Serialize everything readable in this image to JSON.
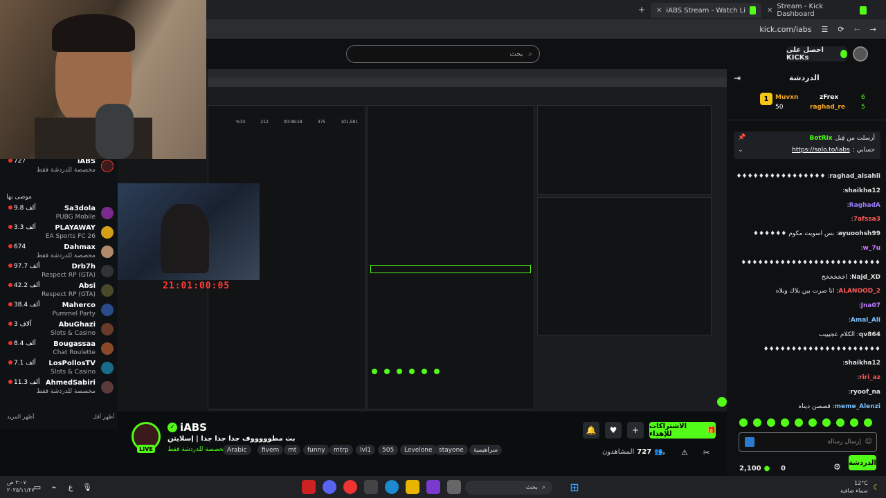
{
  "browser": {
    "tabs": [
      {
        "title": "iABS Stream - Watch Live on K",
        "active": true
      },
      {
        "title": "Stream - Kick Dashboard",
        "active": false
      }
    ],
    "url": "kick.com/iabs"
  },
  "header": {
    "search_placeholder": "بحث",
    "get_kicks": "احصل على KICKs"
  },
  "sidebar": {
    "top_channel": {
      "name": "iABS",
      "count": "727",
      "subtitle": "مخصصة للدردشة فقط"
    },
    "recommended_title": "موصى بها",
    "items": [
      {
        "name": "Sa3dola",
        "count": "9.8 ألف",
        "game": "PUBG Mobile",
        "color": "#7a2a8a"
      },
      {
        "name": "PLAYAWAY",
        "count": "3.3 ألف",
        "game": "EA Sports FC 26",
        "color": "#d4a017"
      },
      {
        "name": "Dahmax",
        "count": "674",
        "game": "مخصصة للدردشة فقط",
        "color": "#b08a6a"
      },
      {
        "name": "Drb7h",
        "count": "97.7 ألف",
        "game": "Respect RP (GTA)",
        "color": "#333"
      },
      {
        "name": "Absi",
        "count": "42.2 ألف",
        "game": "Respect RP (GTA)",
        "color": "#4a4a2a"
      },
      {
        "name": "Maherco",
        "count": "38.4 ألف",
        "game": "Pummel Party",
        "color": "#2a4a8a"
      },
      {
        "name": "AbuGhazi",
        "count": "3 آلاف",
        "game": "Slots & Casino",
        "color": "#6a3a2a"
      },
      {
        "name": "Bougassaa",
        "count": "8.4 ألف",
        "game": "Chat Roulette",
        "color": "#8a4a2a"
      },
      {
        "name": "LosPollosTV",
        "count": "7.1 ألف",
        "game": "Slots & Casino",
        "color": "#1a6a8a"
      },
      {
        "name": "AhmedSabiri",
        "count": "11.3 ألف",
        "game": "مخصصة للدردشة فقط",
        "color": "#5a3a3a"
      }
    ],
    "show_more": "أظهر المزيد",
    "show_less": "أظهر أقل"
  },
  "video": {
    "timer": "21:01:00:05",
    "inner_stats": [
      "641",
      "101,581",
      "375",
      "00:08:18",
      "212",
      "%33"
    ]
  },
  "stream": {
    "channel_name": "iABS",
    "live": "LIVE",
    "title": "بث مطوووووف جدا جدا جدا | إسلايتن",
    "category": "مخصصة للدردشة فقط",
    "tags": [
      "Arabic",
      "fivem",
      "mt",
      "funny",
      "mtrp",
      "lvl1",
      "505",
      "Levelone",
      "stayone",
      "سراهيمية"
    ],
    "subscribe": "الاشتراكات للإهداء",
    "viewers": "727",
    "viewers_label": "المشاهدون"
  },
  "chat": {
    "title": "الدردشة",
    "leaders": [
      {
        "name": "zFrex",
        "count": "6"
      },
      {
        "name": "Muvxn",
        "count": "50"
      },
      {
        "name": "raghad_re",
        "count": "5"
      }
    ],
    "pinned_by": "أرسلت من قِبل",
    "pinned_user": "BotRix",
    "pinned_text": "حسابي :",
    "pinned_link": "https://solo.to/iabs",
    "messages": [
      {
        "user": "raghad_alsahli",
        "text": "♦♦♦♦♦♦♦♦♦♦♦♦♦♦♦♦",
        "color": "#e0e0e0"
      },
      {
        "user": "shaikha12",
        "text": "",
        "color": "#e0e0e0"
      },
      {
        "user": "RaghadA",
        "text": "",
        "color": "#9a7cff"
      },
      {
        "user": "7afssa3",
        "text": "",
        "color": "#ff5a5a"
      },
      {
        "user": "ayuoohsh99",
        "text": "بس اسويت مكوم ♦♦♦♦♦♦",
        "color": "#e0e0e0"
      },
      {
        "user": "w_7u",
        "text": "",
        "color": "#d07cff"
      },
      {
        "user": "",
        "text": "♦♦♦♦♦♦♦♦♦♦♦♦♦♦♦♦♦♦♦♦♦♦♦♦♦",
        "color": "#e0e0e0"
      },
      {
        "user": "Najd_XD",
        "text": "اخخخخخخ",
        "color": "#e0e0e0"
      },
      {
        "user": "ALANOOD_2",
        "text": "انا صرت بين بلاك وبلاه",
        "color": "#ff5a5a"
      },
      {
        "user": "Jna07",
        "text": "",
        "color": "#c07cff"
      },
      {
        "user": "Amal_Ali",
        "text": "",
        "color": "#7cc0ff"
      },
      {
        "user": "qv864",
        "text": "الكلام عجيييب",
        "color": "#e0e0e0"
      },
      {
        "user": "",
        "text": "♦♦♦♦♦♦♦♦♦♦♦♦♦♦♦♦♦♦♦♦♦",
        "color": "#e0e0e0"
      },
      {
        "user": "shaikha12",
        "text": "",
        "color": "#e0e0e0"
      },
      {
        "user": "riri_az",
        "text": "",
        "color": "#ff5a5a"
      },
      {
        "user": "ryoof_na",
        "text": "",
        "color": "#e0e0e0"
      },
      {
        "user": "meme_Alenzi",
        "text": "قصصن ديناه",
        "color": "#7cc0ff"
      }
    ],
    "input_placeholder": "إرسال رسالة",
    "kicks_balance": "2,100",
    "points": "0",
    "send": "الدردشة"
  },
  "taskbar": {
    "search": "بحث",
    "time": "٣:٠٧ ص",
    "date": "٢٠٢٥/١١/٢٧",
    "temp": "12°C",
    "weather": "سماء صافية"
  },
  "colors": {
    "kick_green": "#53fc18",
    "live_red": "#ff3b3b"
  }
}
